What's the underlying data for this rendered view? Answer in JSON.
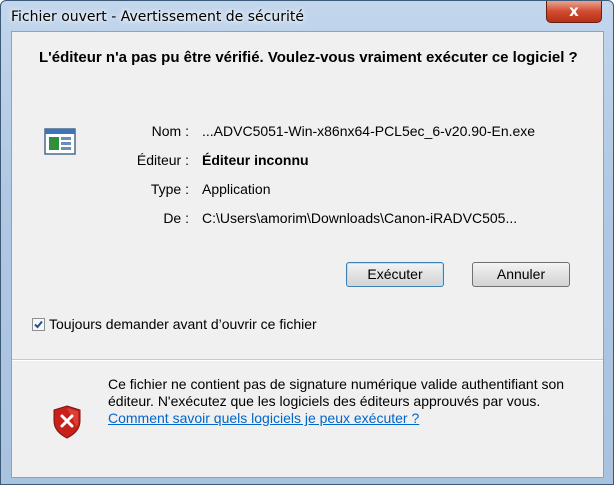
{
  "window": {
    "title": "Fichier ouvert - Avertissement de sécurité",
    "close_label": "x"
  },
  "dialog": {
    "heading": "L'éditeur n'a pas pu être vérifié. Voulez-vous vraiment exécuter ce logiciel ?",
    "fields": {
      "name_label": "Nom :",
      "name_value": "...ADVC5051-Win-x86nx64-PCL5ec_6-v20.90-En.exe",
      "publisher_label": "Éditeur :",
      "publisher_value": "Éditeur inconnu",
      "type_label": "Type :",
      "type_value": "Application",
      "from_label": "De :",
      "from_value": "C:\\Users\\amorim\\Downloads\\Canon-iRADVC505..."
    },
    "buttons": {
      "run": "Exécuter",
      "cancel": "Annuler"
    },
    "checkbox": {
      "label": "Toujours demander avant d’ouvrir ce fichier",
      "checked": true
    },
    "warning": {
      "text": "Ce fichier ne contient pas de signature numérique valide authentifiant son éditeur. N'exécutez que les logiciels des éditeurs approuvés par vous. ",
      "link": "Comment savoir quels logiciels je peux exécuter ?"
    }
  },
  "icons": {
    "program": "program-icon",
    "shield": "security-shield-icon",
    "check": "checkmark-icon"
  },
  "colors": {
    "link": "#0066cc",
    "shield_red": "#c8211b",
    "title_bar": "#b9cfe7"
  }
}
